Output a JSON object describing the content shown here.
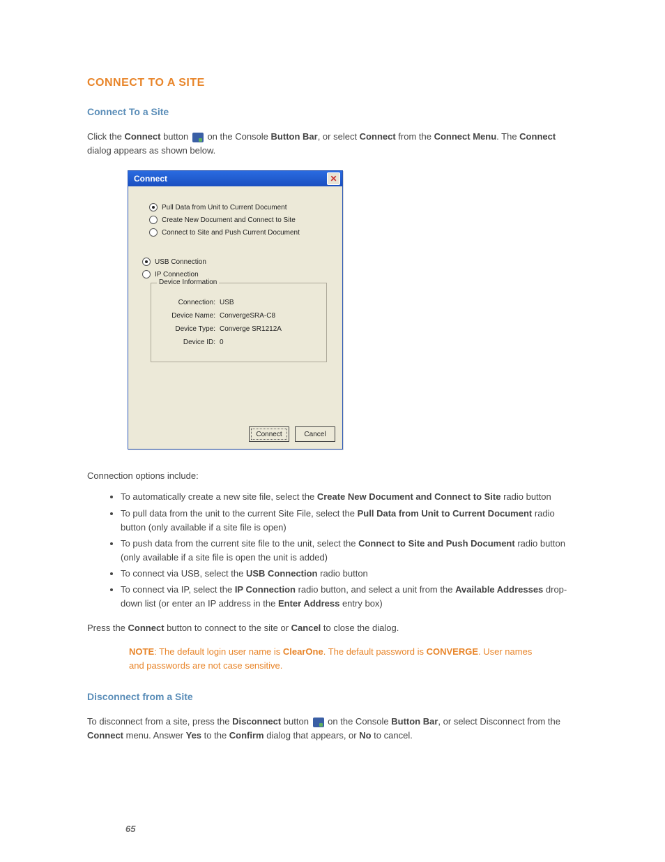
{
  "heading": "CONNECT TO A SITE",
  "sub1": "Connect To a Site",
  "intro": {
    "p1a": "Click the ",
    "p1b": "Connect",
    "p1c": " button ",
    "p1d": " on the Console ",
    "p1e": "Button Bar",
    "p1f": ", or select ",
    "p1g": "Connect",
    "p1h": " from the ",
    "p1i": "Connect Menu",
    "p1j": ". The ",
    "p1k": "Connect",
    "p1l": " dialog appears as shown below."
  },
  "dialog": {
    "title": "Connect",
    "opt1": "Pull Data from Unit to Current Document",
    "opt2": "Create New Document and Connect to Site",
    "opt3": "Connect to Site and Push Current Document",
    "usb": "USB Connection",
    "ip": "IP Connection",
    "legend": "Device Information",
    "rows": {
      "conn_l": "Connection:",
      "conn_v": "USB",
      "name_l": "Device Name:",
      "name_v": "ConvergeSRA-C8",
      "type_l": "Device Type:",
      "type_v": "Converge SR1212A",
      "id_l": "Device ID:",
      "id_v": "0"
    },
    "btn_connect": "Connect",
    "btn_cancel": "Cancel"
  },
  "options_intro": "Connection options include:",
  "bullets": {
    "b1a": "To automatically create a new site file, select the ",
    "b1b": "Create New Document and Connect to Site",
    "b1c": " radio button",
    "b2a": "To pull data from the unit to the current Site File, select the ",
    "b2b": "Pull Data from Unit to Current Document",
    "b2c": " radio button (only available if a site file is open)",
    "b3a": "To push data from the current site file to the unit, select the ",
    "b3b": "Connect to Site and Push Document",
    "b3c": " radio button (only available if a site file is open the unit is added)",
    "b4a": "To connect via USB, select the ",
    "b4b": "USB Connection",
    "b4c": " radio button",
    "b5a": "To connect via IP, select the ",
    "b5b": "IP Connection",
    "b5c": " radio button, and select a unit from the ",
    "b5d": "Available Addresses",
    "b5e": " drop-down list (or enter an IP address in the ",
    "b5f": "Enter Address",
    "b5g": " entry box)"
  },
  "press": {
    "a": "Press the ",
    "b": "Connect",
    "c": " button to connect to the site or ",
    "d": "Cancel",
    "e": " to close the dialog."
  },
  "note": {
    "label": "NOTE",
    "a": ": The default login user name is ",
    "b": "ClearOne",
    "c": ". The default password is ",
    "d": "CONVERGE",
    "e": ". User names and passwords are not case sensitive."
  },
  "sub2": "Disconnect from a Site",
  "disc": {
    "a": "To disconnect from a site, press the ",
    "b": "Disconnect",
    "c": " button ",
    "d": " on the Console ",
    "e": "Button Bar",
    "f": ", or select Disconnect from the ",
    "g": "Connect",
    "h": " menu. Answer ",
    "i": "Yes",
    "j": " to the ",
    "k": "Confirm",
    "l": " dialog that appears, or ",
    "m": "No",
    "n": " to cancel."
  },
  "pagenum": "65"
}
